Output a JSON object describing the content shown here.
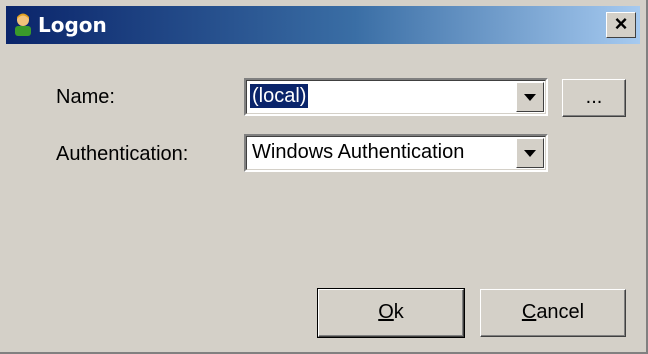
{
  "window": {
    "title": "Logon",
    "close_label": "×"
  },
  "form": {
    "name": {
      "label": "Name:",
      "value": "(local)"
    },
    "authentication": {
      "label": "Authentication:",
      "value": "Windows Authentication"
    },
    "browse_label": "..."
  },
  "buttons": {
    "ok": {
      "accel": "O",
      "rest": "k"
    },
    "cancel": {
      "accel": "C",
      "rest": "ancel"
    }
  },
  "icons": [
    "user-icon",
    "chevron-down-icon"
  ]
}
